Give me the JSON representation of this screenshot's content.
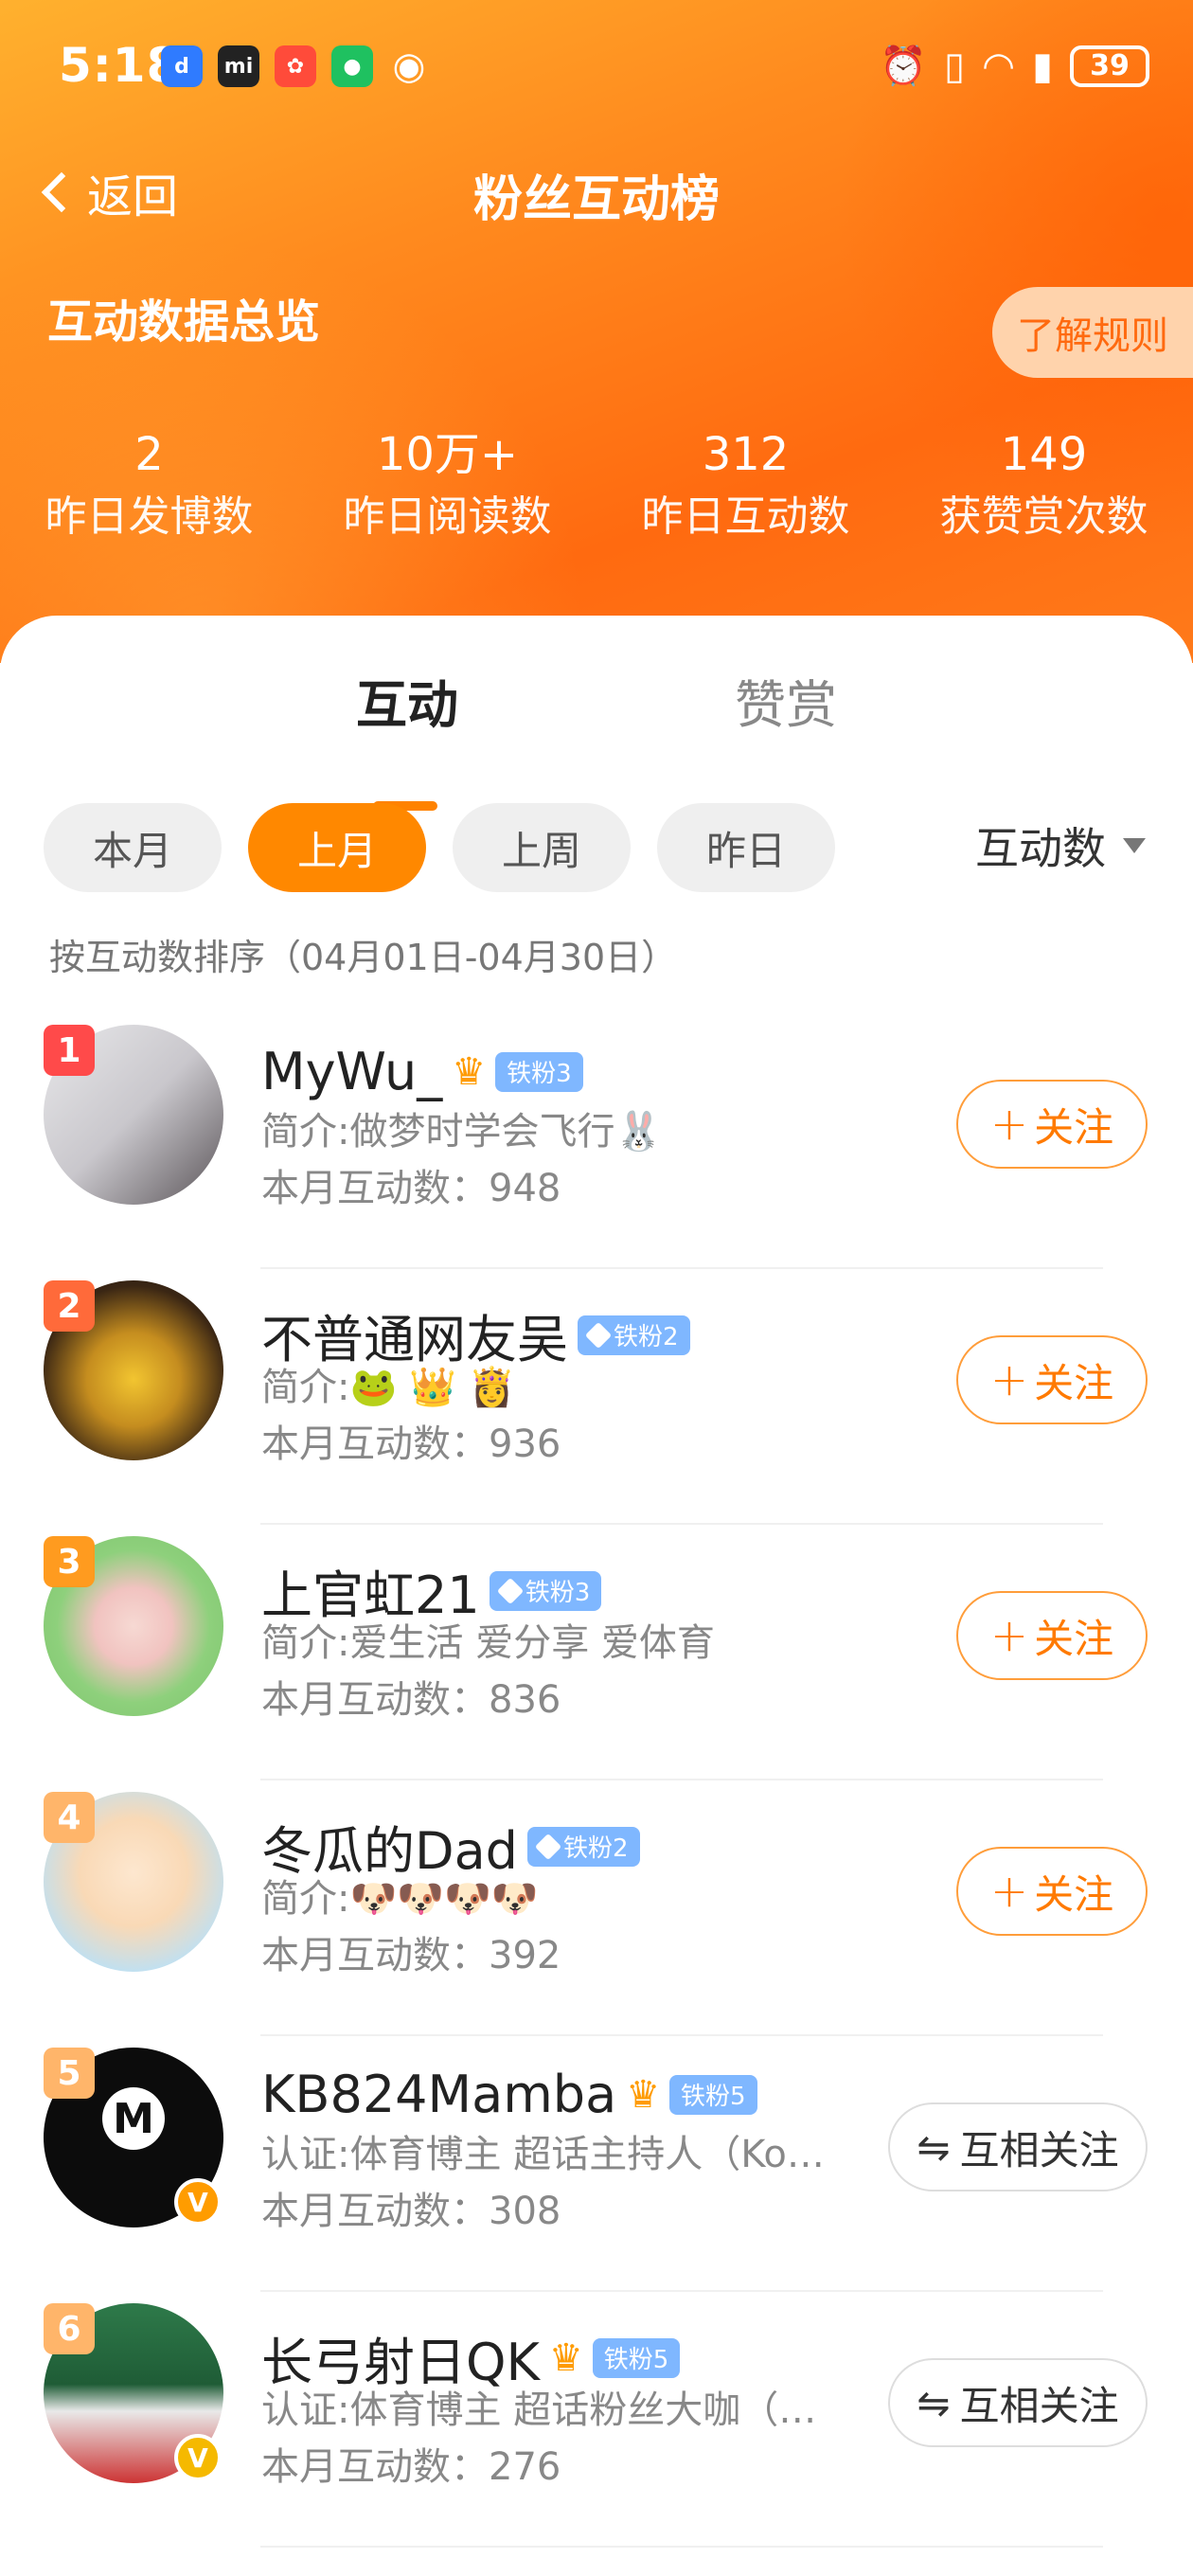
{
  "status_bar": {
    "time": "5:18",
    "app_icons": [
      "weibo-icon",
      "xiaomi-icon",
      "app-icon",
      "wechat-icon",
      "eye-icon"
    ],
    "battery": "39"
  },
  "nav": {
    "back_label": "返回",
    "title": "粉丝互动榜"
  },
  "overview": {
    "title": "互动数据总览",
    "rules_label": "了解规则",
    "stats": [
      {
        "value": "2",
        "label": "昨日发博数"
      },
      {
        "value": "10万+",
        "label": "昨日阅读数"
      },
      {
        "value": "312",
        "label": "昨日互动数"
      },
      {
        "value": "149",
        "label": "获赞赏次数"
      }
    ]
  },
  "tabs": [
    {
      "label": "互动"
    },
    {
      "label": "赞赏"
    }
  ],
  "filters": [
    {
      "label": "本月"
    },
    {
      "label": "上月"
    },
    {
      "label": "上周"
    },
    {
      "label": "昨日"
    }
  ],
  "sort": {
    "label": "互动数"
  },
  "range_note": "按互动数排序（04月01日-04月30日）",
  "fans": [
    {
      "rank": "1",
      "name": "MyWu_",
      "badge": "铁粉3",
      "desc": "简介:做梦时学会飞行🐰",
      "count": "本月互动数：948",
      "action": "关注"
    },
    {
      "rank": "2",
      "name": "不普通网友吴",
      "badge": "铁粉2",
      "desc": "简介:🐸 👑 👸",
      "count": "本月互动数：936",
      "action": "关注"
    },
    {
      "rank": "3",
      "name": "上官虹21",
      "badge": "铁粉3",
      "desc": "简介:爱生活 爱分享 爱体育",
      "count": "本月互动数：836",
      "action": "关注"
    },
    {
      "rank": "4",
      "name": "冬瓜的Dad",
      "badge": "铁粉2",
      "desc": "简介:🐶🐶🐶🐶",
      "count": "本月互动数：392",
      "action": "关注"
    },
    {
      "rank": "5",
      "name": "KB824Mamba",
      "badge": "铁粉5",
      "desc": "认证:体育博主 超话主持人（Ko…",
      "count": "本月互动数：308",
      "action": "互相关注"
    },
    {
      "rank": "6",
      "name": "长弓射日QK",
      "badge": "铁粉5",
      "desc": "认证:体育博主 超话粉丝大咖（…",
      "count": "本月互动数：276",
      "action": "互相关注"
    }
  ],
  "colors": {
    "accent": "#ff8800",
    "badge": "#7fb7ff"
  }
}
